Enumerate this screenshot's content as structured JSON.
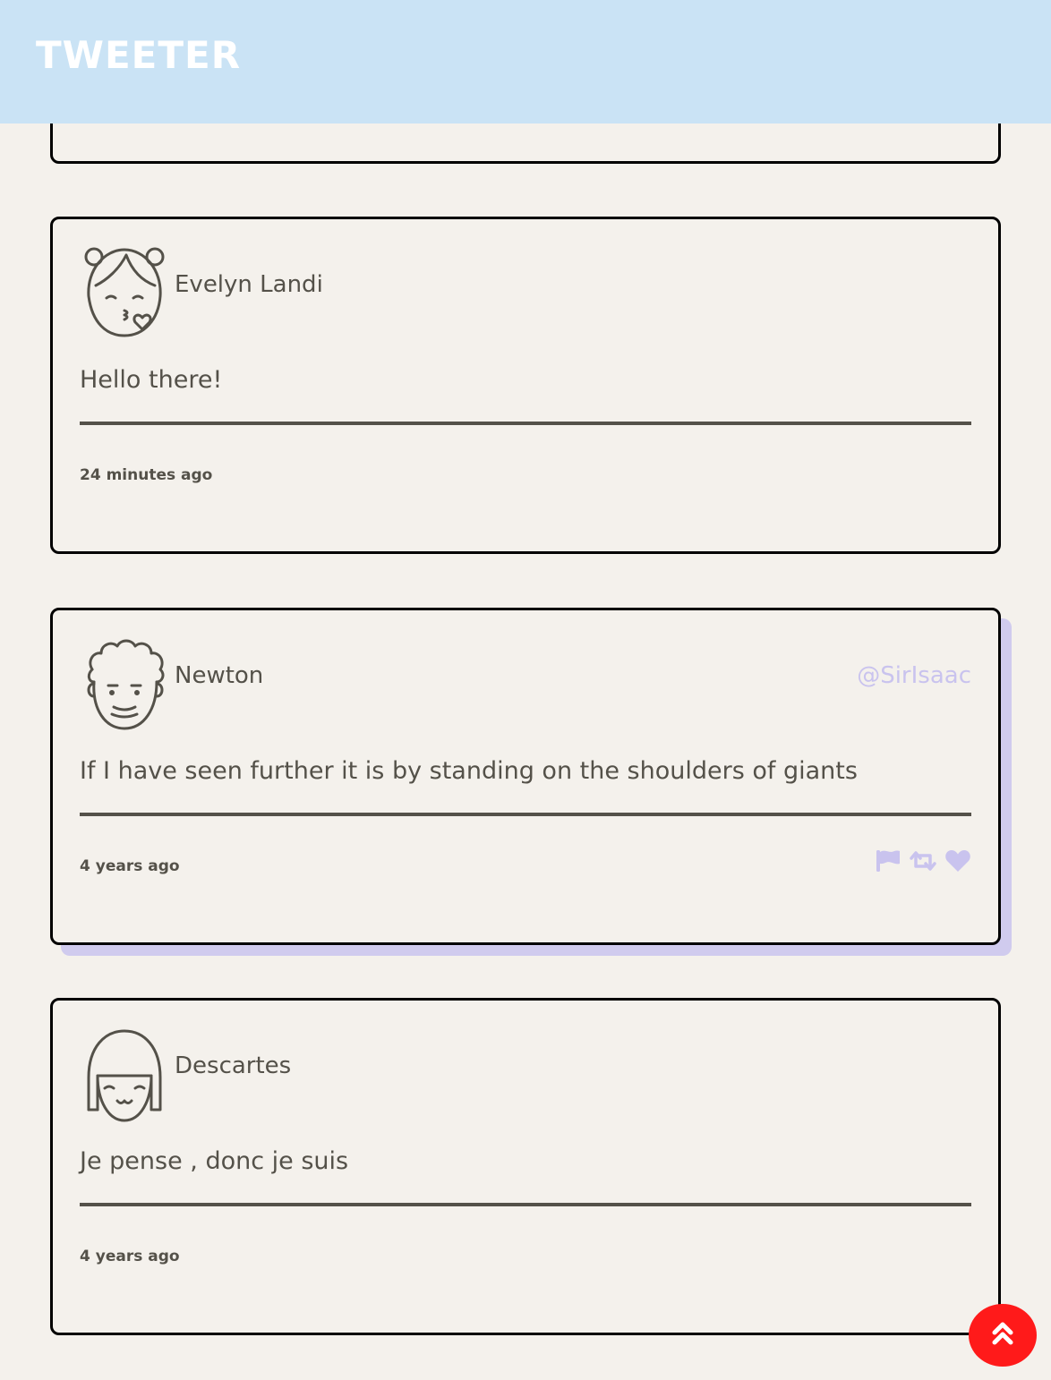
{
  "header": {
    "brand": "TWEETER"
  },
  "tweets": [
    {
      "name": "Evelyn Landi",
      "handle": "",
      "content": "Hello there!",
      "time": "24 minutes ago",
      "avatar": "kissing-girl-avatar"
    },
    {
      "name": "Newton",
      "handle": "@SirIsaac",
      "content": "If I have seen further it is by standing on the shoulders of giants",
      "time": "4 years ago",
      "avatar": "curly-hair-man-avatar"
    },
    {
      "name": "Descartes",
      "handle": "",
      "content": "Je pense , donc je suis",
      "time": "4 years ago",
      "avatar": "bob-hair-girl-avatar"
    }
  ],
  "actions": {
    "icons": [
      "flag-icon",
      "retweet-icon",
      "heart-icon"
    ],
    "color": "#c9c3ee"
  },
  "colors": {
    "header_bg": "#cae3f5",
    "page_bg": "#f4f1ec",
    "text": "#545149",
    "accent": "#c9c3ee",
    "fab": "#ff1a1a"
  },
  "scroll_top": {
    "icon": "double-chevron-up-icon"
  }
}
